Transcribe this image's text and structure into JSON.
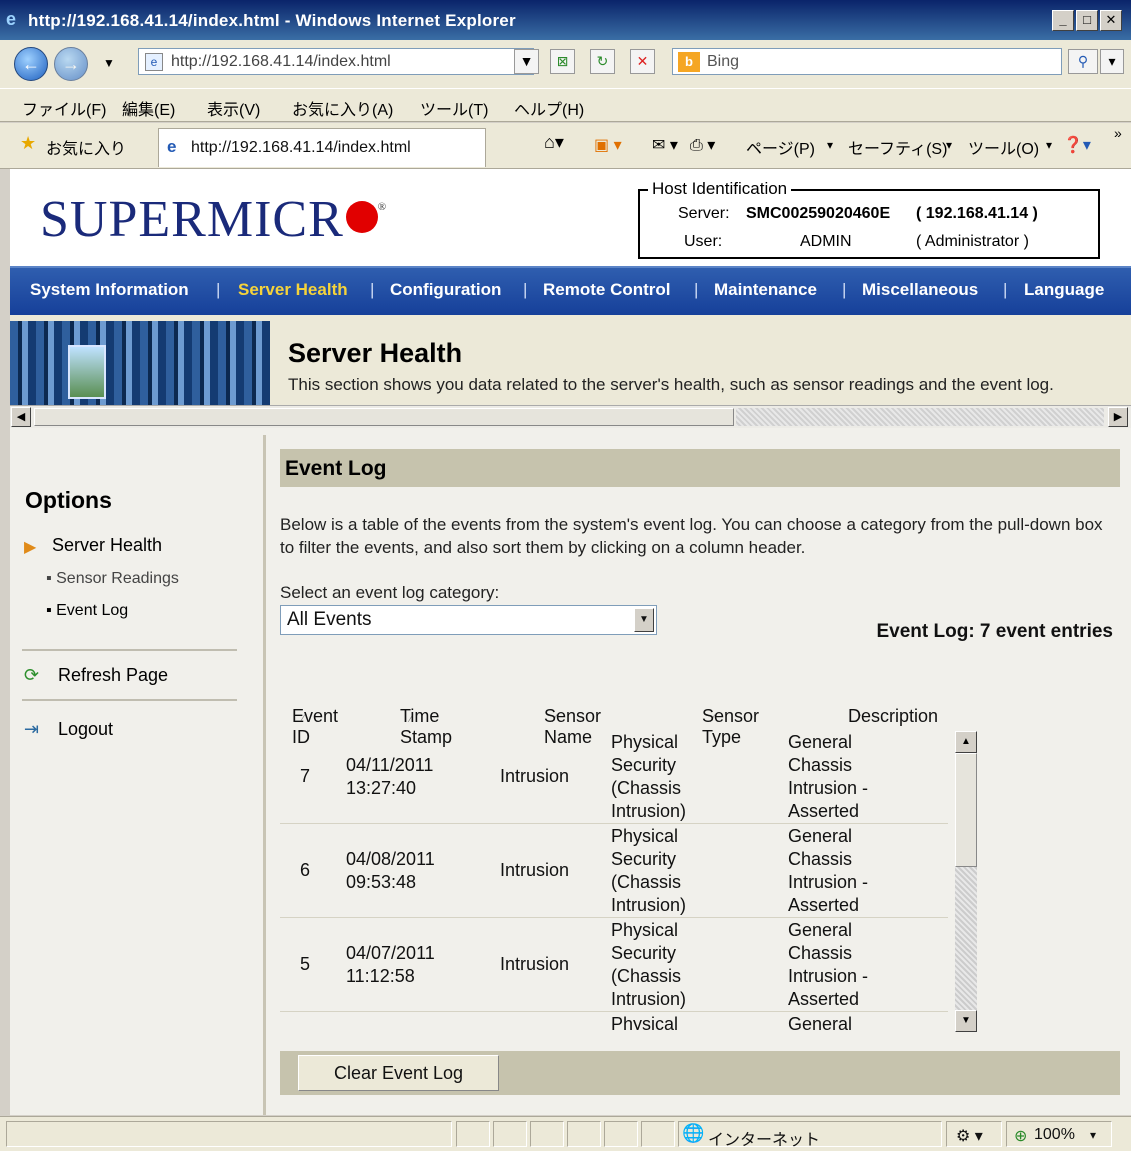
{
  "window": {
    "title": "http://192.168.41.14/index.html - Windows Internet Explorer"
  },
  "browser": {
    "address": "http://192.168.41.14/index.html",
    "search_placeholder": "Bing",
    "menu": [
      "ファイル(F)",
      "編集(E)",
      "表示(V)",
      "お気に入り(A)",
      "ツール(T)",
      "ヘルプ(H)"
    ],
    "favorites_label": "お気に入り",
    "tab_title": "http://192.168.41.14/index.html",
    "cmd_page": "ページ(P)",
    "cmd_safety": "セーフティ(S)",
    "cmd_tools": "ツール(O)",
    "status_zone": "インターネット",
    "zoom": "100%"
  },
  "header": {
    "logo": "SUPERMICR",
    "host_legend": "Host Identification",
    "server_label": "Server:",
    "server_value": "SMC00259020460E",
    "server_ip": "( 192.168.41.14 )",
    "user_label": "User:",
    "user_value": "ADMIN",
    "user_role": "( Administrator )"
  },
  "nav": {
    "items": [
      "System Information",
      "Server Health",
      "Configuration",
      "Remote Control",
      "Maintenance",
      "Miscellaneous",
      "Language"
    ],
    "active": "Server Health",
    "active_color": "#f5d33b"
  },
  "banner": {
    "title": "Server Health",
    "description": "This section shows you data related to the server's health, such as sensor readings and the event log."
  },
  "sidebar": {
    "heading": "Options",
    "section": "Server Health",
    "sub_items": [
      "Sensor Readings",
      "Event Log"
    ],
    "refresh": "Refresh Page",
    "logout": "Logout"
  },
  "main": {
    "title": "Event Log",
    "description": "Below is a table of the events from the system's event log. You can choose a category from the pull-down box to filter the events, and also sort them by clicking on a column header.",
    "category_label": "Select an event log category:",
    "category_value": "All Events",
    "entry_count": "Event Log: 7 event entries",
    "columns": [
      "Event ID",
      "Time Stamp",
      "Sensor Name",
      "Sensor Type",
      "Description"
    ],
    "rows": [
      {
        "id": "7",
        "date": "04/11/2011",
        "time": "13:27:40",
        "sensor": "Intrusion",
        "type": [
          "Physical",
          "Security",
          "(Chassis",
          "Intrusion)"
        ],
        "desc": [
          "General",
          "Chassis",
          "Intrusion -",
          "Asserted"
        ]
      },
      {
        "id": "6",
        "date": "04/08/2011",
        "time": "09:53:48",
        "sensor": "Intrusion",
        "type": [
          "Physical",
          "Security",
          "(Chassis",
          "Intrusion)"
        ],
        "desc": [
          "General",
          "Chassis",
          "Intrusion -",
          "Asserted"
        ]
      },
      {
        "id": "5",
        "date": "04/07/2011",
        "time": "11:12:58",
        "sensor": "Intrusion",
        "type": [
          "Physical",
          "Security",
          "(Chassis",
          "Intrusion)"
        ],
        "desc": [
          "General",
          "Chassis",
          "Intrusion -",
          "Asserted"
        ]
      },
      {
        "id": "",
        "date": "",
        "time": "",
        "sensor": "",
        "type": [
          "Physical"
        ],
        "desc": [
          "General"
        ]
      }
    ],
    "clear_button": "Clear Event Log"
  }
}
